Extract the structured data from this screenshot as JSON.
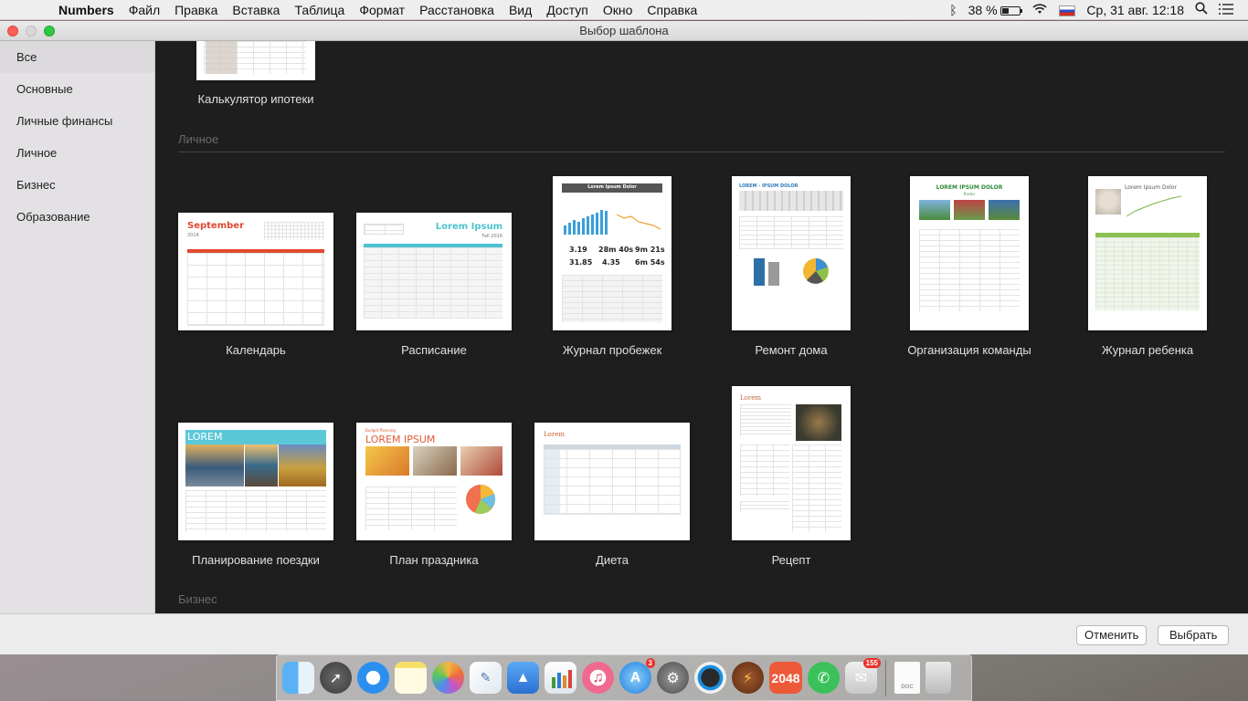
{
  "menubar": {
    "app_name": "Numbers",
    "items": [
      "Файл",
      "Правка",
      "Вставка",
      "Таблица",
      "Формат",
      "Расстановка",
      "Вид",
      "Доступ",
      "Окно",
      "Справка"
    ],
    "battery": "38 %",
    "datetime": "Ср, 31 авг.  12:18"
  },
  "window": {
    "title": "Выбор шаблона"
  },
  "sidebar": {
    "items": [
      "Все",
      "Основные",
      "Личные финансы",
      "Личное",
      "Бизнес",
      "Образование"
    ]
  },
  "sections": {
    "personal": "Личное",
    "business": "Бизнес"
  },
  "templates": {
    "mortgage": "Калькулятор ипотеки",
    "calendar": "Календарь",
    "schedule": "Расписание",
    "running": "Журнал пробежек",
    "home": "Ремонт дома",
    "team": "Организация команды",
    "baby": "Журнал ребенка",
    "trip": "Планирование поездки",
    "party": "План праздника",
    "diet": "Диета",
    "recipe": "Рецепт"
  },
  "thumb_text": {
    "calendar_month": "September",
    "calendar_year": "2014",
    "schedule_title": "Lorem Ipsum",
    "schedule_sub": "Fall 2016",
    "running_title": "Lorem Ipsum Dolor",
    "running_stats": [
      "3.19",
      "28m 40s",
      "9m 21s",
      "31.85",
      "4.35",
      "6m 54s"
    ],
    "home_title": "LOREM - IPSUM DOLOR",
    "team_title": "LOREM IPSUM DOLOR",
    "team_sub": "Roster",
    "baby_title": "Lorem Ipsum Dolor",
    "trip_title": "LOREM",
    "party_title": "LOREM IPSUM",
    "party_small": "Budget Planning",
    "diet_title": "Lorem",
    "recipe_title": "Lorem"
  },
  "buttons": {
    "cancel": "Отменить",
    "choose": "Выбрать"
  },
  "dock": {
    "badges": {
      "appstore": "3",
      "mail": "155"
    },
    "game_2048": "2048",
    "doc_label": "DOC"
  }
}
